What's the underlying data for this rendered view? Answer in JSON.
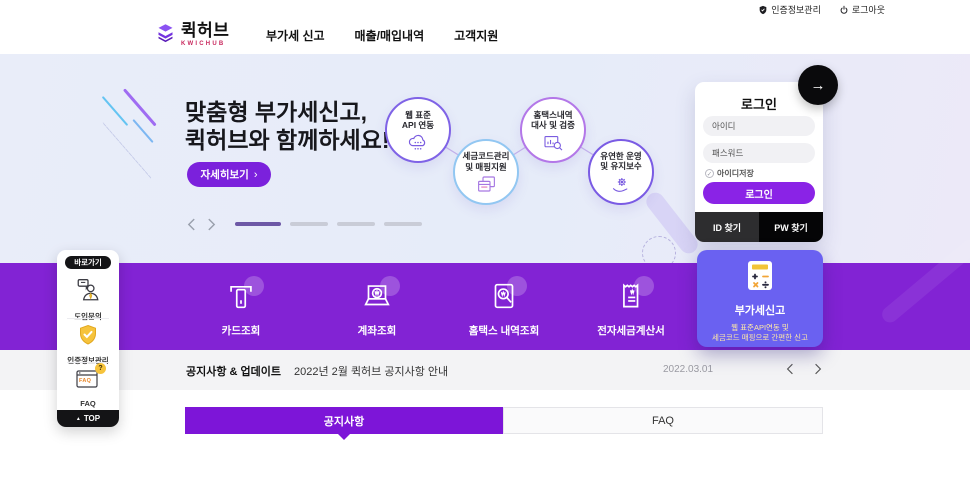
{
  "icons": {
    "arrow_right": "→",
    "chevron_right": "›",
    "triangle_up": "▲",
    "check": "✓"
  },
  "topbar": {
    "cert_label": "인증정보관리",
    "logout_label": "로그아웃"
  },
  "header": {
    "logo_text": "퀵허브",
    "logo_sub": "KWICHUB",
    "nav": [
      {
        "label": "부가세 신고"
      },
      {
        "label": "매출/매입내역"
      },
      {
        "label": "고객지원"
      }
    ]
  },
  "hero": {
    "title_line1": "맞춤형 부가세신고,",
    "title_line2": "퀵허브와 함께하세요!",
    "cta_label": "자세히보기",
    "features": [
      {
        "line1": "웹 표준",
        "line2": "API 연동"
      },
      {
        "line1": "세금코드관리",
        "line2": "및 매핑지원"
      },
      {
        "line1": "홈택스내역",
        "line2": "대사 및 검증"
      },
      {
        "line1": "유연한 운영",
        "line2": "및 유지보수"
      }
    ]
  },
  "login": {
    "title": "로그인",
    "id_placeholder": "아이디",
    "pw_placeholder": "패스워드",
    "remember_label": "아이디저장",
    "submit_label": "로그인",
    "find_id_label": "ID 찾기",
    "find_pw_label": "PW 찾기"
  },
  "services": [
    {
      "label": "카드조회"
    },
    {
      "label": "계좌조회"
    },
    {
      "label": "홈택스 내역조회"
    },
    {
      "label": "전자세금계산서"
    }
  ],
  "vat_card": {
    "title": "부가세신고",
    "desc_line1": "웹 표준API연동 및",
    "desc_line2": "세금코드 매핑으로 간편한 신고"
  },
  "notice": {
    "heading": "공지사항 & 업데이트",
    "item_title": "2022년 2월 퀵허브 공지사항 안내",
    "date": "2022.03.01"
  },
  "tabs": {
    "notice_label": "공지사항",
    "faq_label": "FAQ"
  },
  "quickmenu": {
    "title": "바로가기",
    "items": [
      {
        "label": "도입문의"
      },
      {
        "label": "인증정보관리"
      },
      {
        "label": "FAQ"
      }
    ],
    "faq_icon_text": "FAQ",
    "top_label": "TOP"
  },
  "colors": {
    "band_purple": "#8223d4",
    "button_purple": "#8a23e6",
    "vat_card_blue": "#6a61f1",
    "shield_yellow": "#f6c33c"
  }
}
